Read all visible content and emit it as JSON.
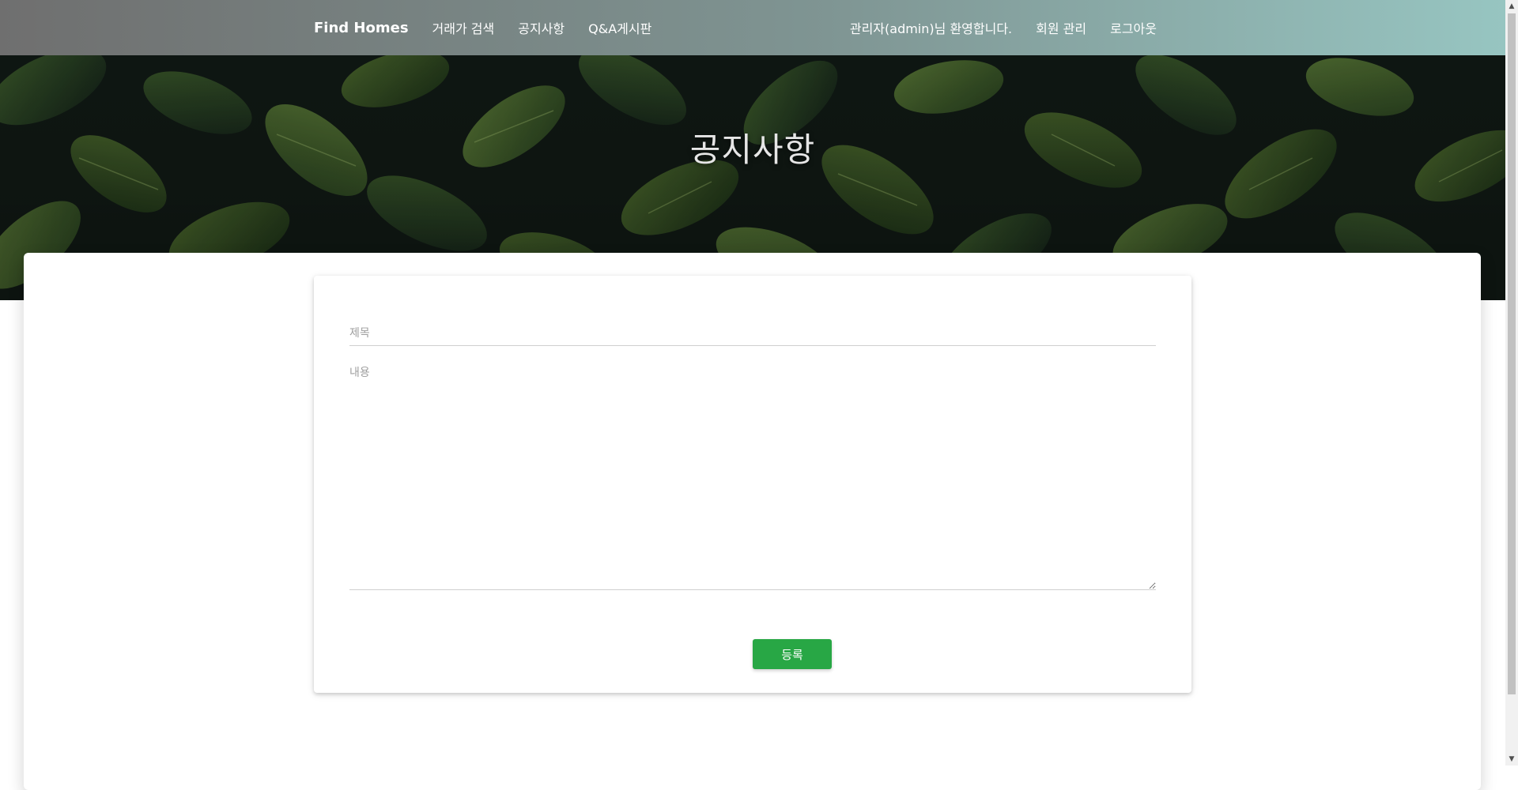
{
  "navbar": {
    "brand": "Find Homes",
    "links": [
      "거래가 검색",
      "공지사항",
      "Q&A게시판"
    ],
    "welcome": "관리자(admin)님 환영합니다.",
    "member_manage": "회원 관리",
    "logout": "로그아웃"
  },
  "hero": {
    "title": "공지사항"
  },
  "form": {
    "title_placeholder": "제목",
    "content_placeholder": "내용",
    "submit_label": "등록"
  },
  "colors": {
    "submit_button": "#28a745",
    "navbar_start": "#6f6f6f",
    "navbar_end": "#97c5c1"
  }
}
